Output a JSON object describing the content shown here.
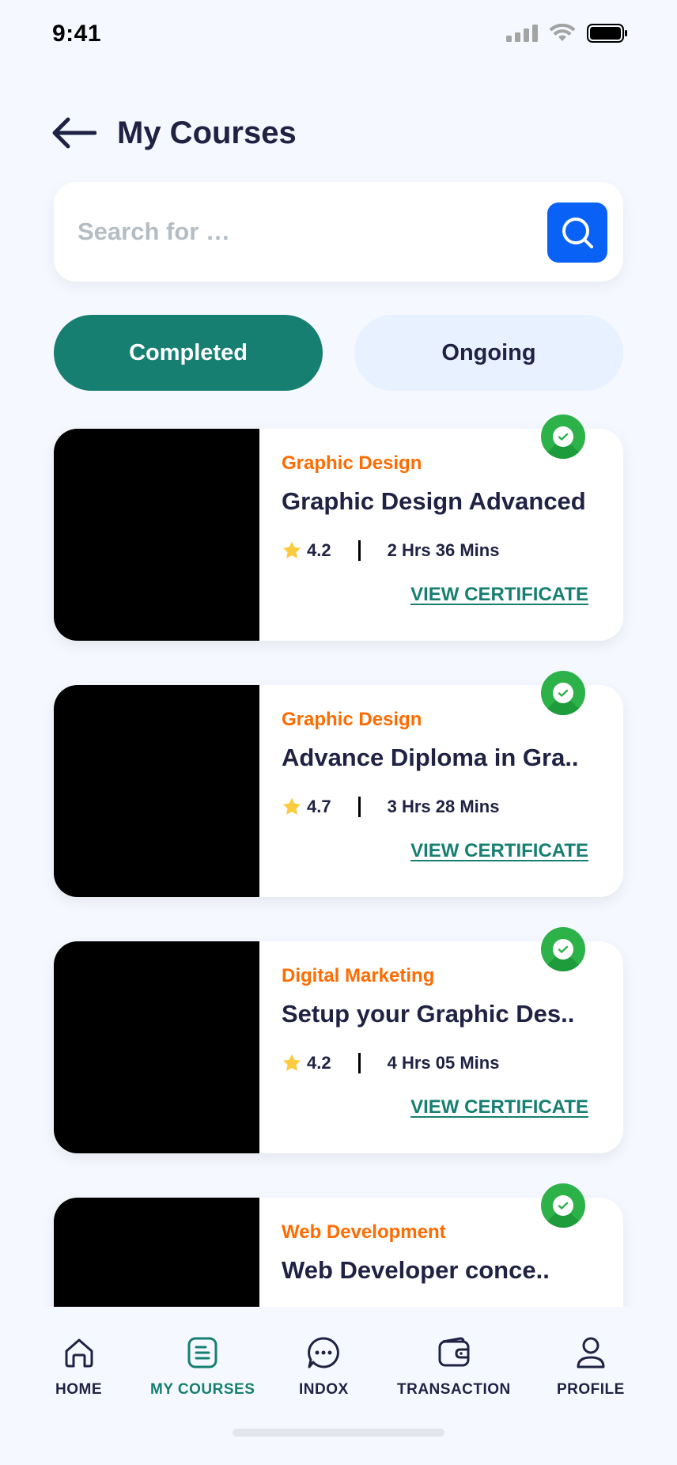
{
  "status_bar": {
    "time": "9:41"
  },
  "header": {
    "title": "My Courses"
  },
  "search": {
    "placeholder": "Search for …"
  },
  "tabs": [
    {
      "label": "Completed",
      "active": true
    },
    {
      "label": "Ongoing",
      "active": false
    }
  ],
  "courses": [
    {
      "category": "Graphic Design",
      "title": "Graphic Design Advanced",
      "rating": "4.2",
      "duration": "2 Hrs 36 Mins",
      "action": "VIEW CERTIFICATE",
      "completed": true
    },
    {
      "category": "Graphic Design",
      "title": "Advance Diploma in Gra..",
      "rating": "4.7",
      "duration": "3 Hrs 28 Mins",
      "action": "VIEW CERTIFICATE",
      "completed": true
    },
    {
      "category": "Digital Marketing",
      "title": "Setup your Graphic Des..",
      "rating": "4.2",
      "duration": "4 Hrs 05 Mins",
      "action": "VIEW CERTIFICATE",
      "completed": true
    },
    {
      "category": "Web Development",
      "title": "Web Developer conce..",
      "completed": true
    }
  ],
  "bottom_nav": [
    {
      "label": "HOME",
      "icon": "home-icon",
      "active": false
    },
    {
      "label": "MY COURSES",
      "icon": "courses-icon",
      "active": true
    },
    {
      "label": "INDOX",
      "icon": "chat-icon",
      "active": false
    },
    {
      "label": "TRANSACTION",
      "icon": "wallet-icon",
      "active": false
    },
    {
      "label": "PROFILE",
      "icon": "profile-icon",
      "active": false
    }
  ],
  "colors": {
    "background": "#F5F9FF",
    "primary": "#167F71",
    "accent_blue": "#0961F5",
    "category_orange": "#FF6B00",
    "text_dark": "#202244",
    "badge_green": "#2DB24A",
    "star": "#FCCB40"
  }
}
